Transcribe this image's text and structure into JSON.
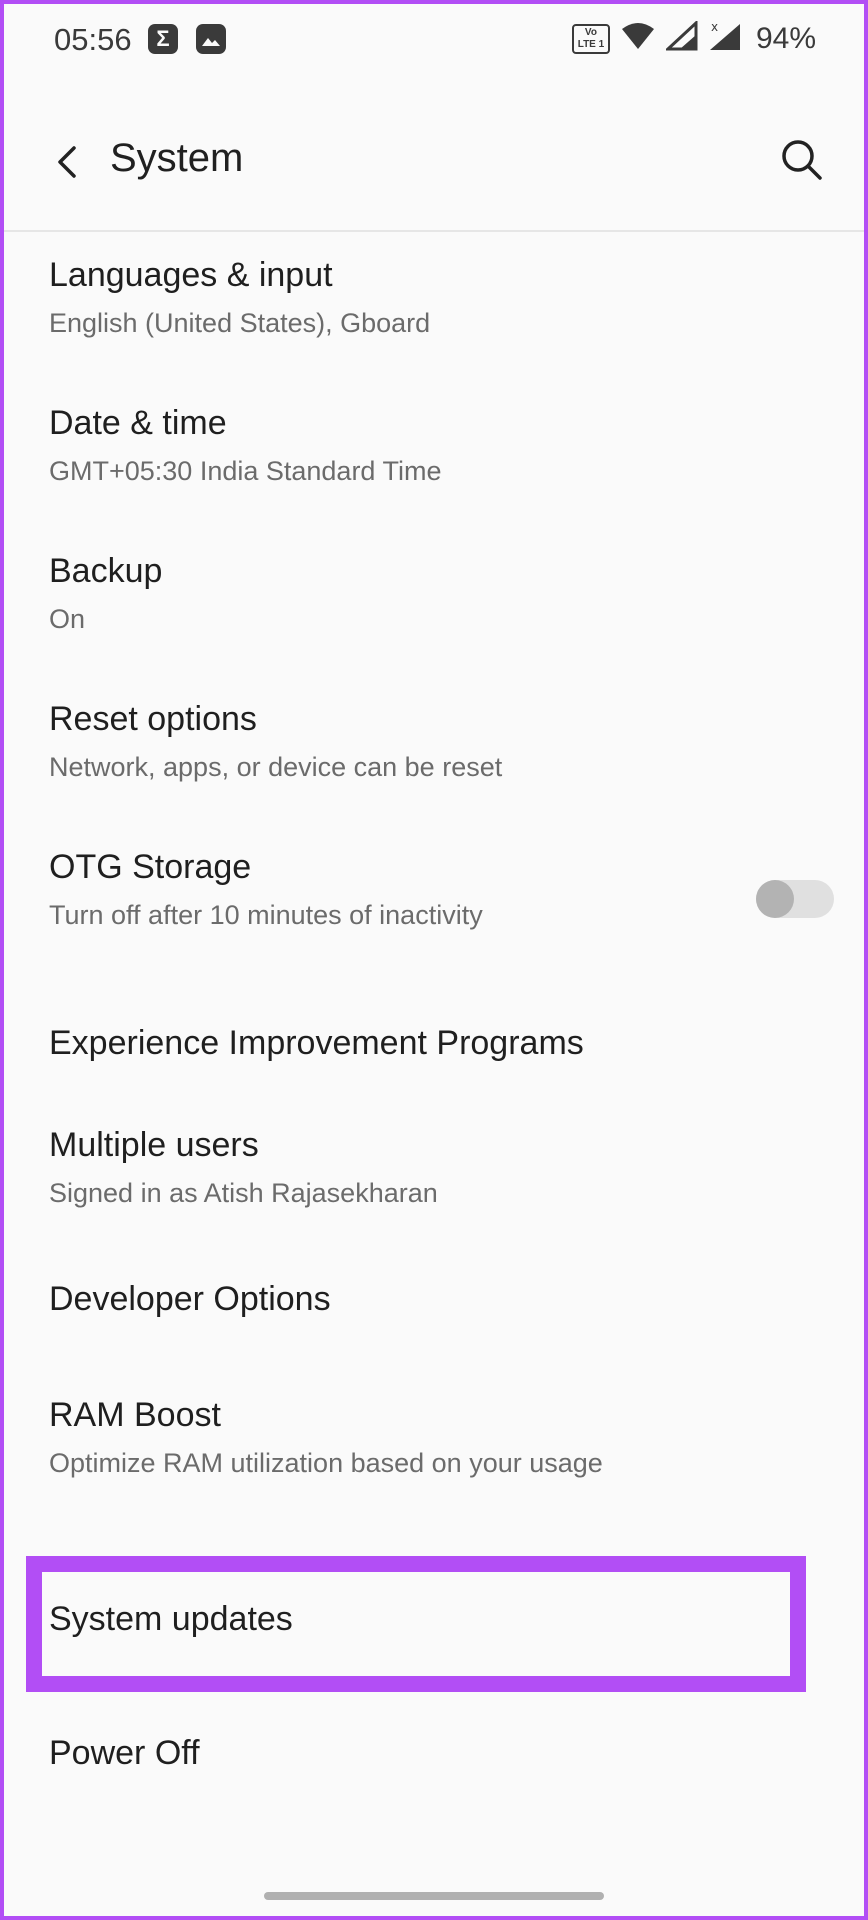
{
  "status_bar": {
    "time": "05:56",
    "app_icon_1": "Σ",
    "battery": "94%",
    "volte_label_top": "Vo",
    "volte_label_bottom": "LTE 1"
  },
  "app_bar": {
    "title": "System",
    "back_icon": "back-arrow-icon",
    "search_icon": "search-icon"
  },
  "items": [
    {
      "title": "Languages & input",
      "subtitle": "English (United States), Gboard"
    },
    {
      "title": "Date & time",
      "subtitle": "GMT+05:30 India Standard Time"
    },
    {
      "title": "Backup",
      "subtitle": "On"
    },
    {
      "title": "Reset options",
      "subtitle": "Network, apps, or device can be reset"
    },
    {
      "title": "OTG Storage",
      "subtitle": "Turn off after 10 minutes of inactivity",
      "toggle_on": false
    },
    {
      "title": "Experience Improvement Programs"
    },
    {
      "title": "Multiple users",
      "subtitle": "Signed in as Atish Rajasekharan"
    },
    {
      "title": "Developer Options"
    },
    {
      "title": "RAM Boost",
      "subtitle": "Optimize RAM utilization based on your usage"
    },
    {
      "title": "System updates"
    },
    {
      "title": "Power Off"
    }
  ],
  "colors": {
    "highlight": "#b24ef5",
    "background": "#fafafa",
    "subtitle": "#6b6b6b"
  }
}
